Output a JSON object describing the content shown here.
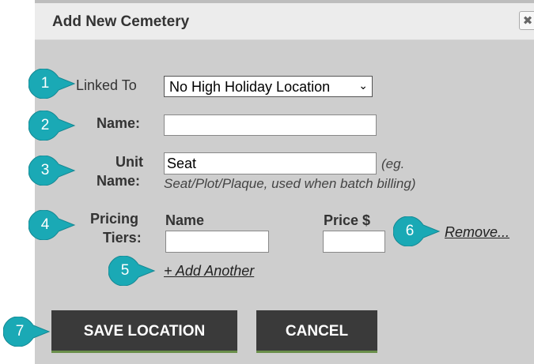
{
  "dialog": {
    "title": "Add New Cemetery",
    "close_icon": "✖"
  },
  "form": {
    "linked_to_label": "Linked To",
    "linked_to_value": "No High Holiday Location",
    "name_label": "Name:",
    "name_value": "",
    "unit_name_label_line1": "Unit",
    "unit_name_label_line2": "Name:",
    "unit_name_value": "Seat",
    "unit_name_hint_line1": "(eg.",
    "unit_name_hint_line2": "Seat/Plot/Plaque, used when batch billing)",
    "pricing_tiers_label_line1": "Pricing",
    "pricing_tiers_label_line2": "Tiers:",
    "tier_name_header": "Name",
    "tier_price_header": "Price $",
    "tier_name_value": "",
    "tier_price_value": "",
    "remove_link": "Remove...",
    "add_another_link": "+ Add Another"
  },
  "buttons": {
    "save": "SAVE LOCATION",
    "cancel": "CANCEL"
  },
  "callouts": [
    "1",
    "2",
    "3",
    "4",
    "5",
    "6",
    "7"
  ],
  "colors": {
    "callout": "#1aa9b5",
    "dialog_bg": "#cecece",
    "titlebar_bg": "#ececec",
    "button_bg": "#3a3a3a",
    "button_accent": "#6a8f4a"
  }
}
